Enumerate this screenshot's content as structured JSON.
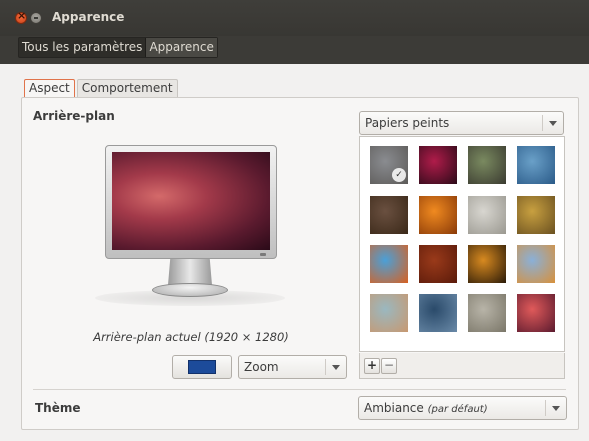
{
  "window": {
    "title": "Apparence",
    "close_icon": "close-icon",
    "minimize_icon": "minimize-icon"
  },
  "breadcrumbs": [
    "Tous les paramètres",
    "Apparence"
  ],
  "tabs": [
    {
      "label": "Aspect",
      "active": true
    },
    {
      "label": "Comportement",
      "active": false
    }
  ],
  "background": {
    "section_title": "Arrière-plan",
    "current_label": "Arrière-plan actuel (1920 × 1280)",
    "color": "#1c4b9a",
    "mode_select": "Zoom",
    "source_select": "Papiers peints",
    "add_label": "+",
    "remove_label": "−",
    "thumbnails": [
      {
        "icon": "wallpaper-thumbnail",
        "selected": true,
        "colors": [
          "#8a8c90",
          "#5c5a58"
        ]
      },
      {
        "icon": "wallpaper-thumbnail",
        "colors": [
          "#b01c4a",
          "#2a0a18"
        ]
      },
      {
        "icon": "wallpaper-thumbnail",
        "colors": [
          "#7a8a60",
          "#3a3a30"
        ]
      },
      {
        "icon": "wallpaper-thumbnail",
        "colors": [
          "#6aa0c8",
          "#2a5a88"
        ]
      },
      {
        "icon": "wallpaper-thumbnail",
        "colors": [
          "#6a5040",
          "#3a2818"
        ]
      },
      {
        "icon": "wallpaper-thumbnail",
        "colors": [
          "#f08a20",
          "#8a3a08"
        ]
      },
      {
        "icon": "wallpaper-thumbnail",
        "colors": [
          "#d8d6d0",
          "#9a9890"
        ]
      },
      {
        "icon": "wallpaper-thumbnail",
        "colors": [
          "#c8a040",
          "#6a5020"
        ]
      },
      {
        "icon": "wallpaper-thumbnail",
        "colors": [
          "#4aa0d8",
          "#d86020"
        ]
      },
      {
        "icon": "wallpaper-thumbnail",
        "colors": [
          "#9a3a1a",
          "#5a1a0a"
        ]
      },
      {
        "icon": "wallpaper-thumbnail",
        "colors": [
          "#d88a20",
          "#2a1a08"
        ]
      },
      {
        "icon": "wallpaper-thumbnail",
        "colors": [
          "#8ab0d8",
          "#d8903a"
        ]
      },
      {
        "icon": "wallpaper-thumbnail",
        "colors": [
          "#9ab8c0",
          "#c89870"
        ]
      },
      {
        "icon": "wallpaper-thumbnail",
        "colors": [
          "#2a4a6a",
          "#6a8aa8"
        ]
      },
      {
        "icon": "wallpaper-thumbnail",
        "colors": [
          "#b8b4a8",
          "#7a7668"
        ]
      },
      {
        "icon": "wallpaper-thumbnail",
        "colors": [
          "#e05a5a",
          "#5a1a2e"
        ]
      }
    ]
  },
  "theme": {
    "section_title": "Thème",
    "name": "Ambiance",
    "default_suffix": "(par défaut)"
  }
}
